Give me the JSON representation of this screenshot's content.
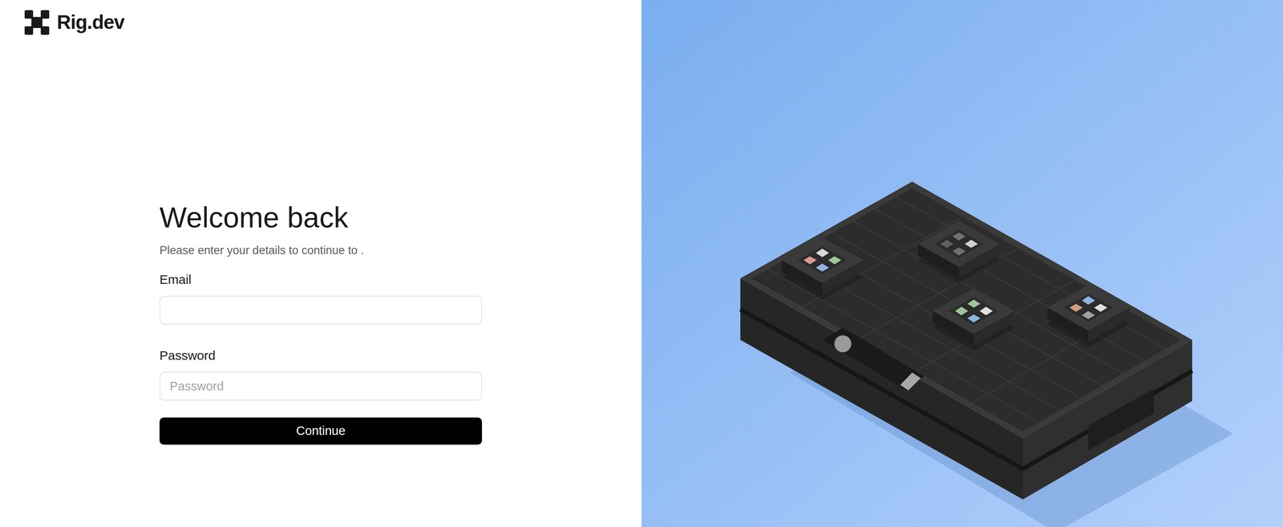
{
  "brand": {
    "name": "Rig.dev"
  },
  "login": {
    "title": "Welcome back",
    "subtitle": "Please enter your details to continue to .",
    "fields": [
      {
        "label": "Email",
        "kind": "email",
        "value": "",
        "placeholder": ""
      },
      {
        "label": "Password",
        "kind": "password",
        "value": "",
        "placeholder": "Password"
      }
    ],
    "submit": "Continue"
  }
}
